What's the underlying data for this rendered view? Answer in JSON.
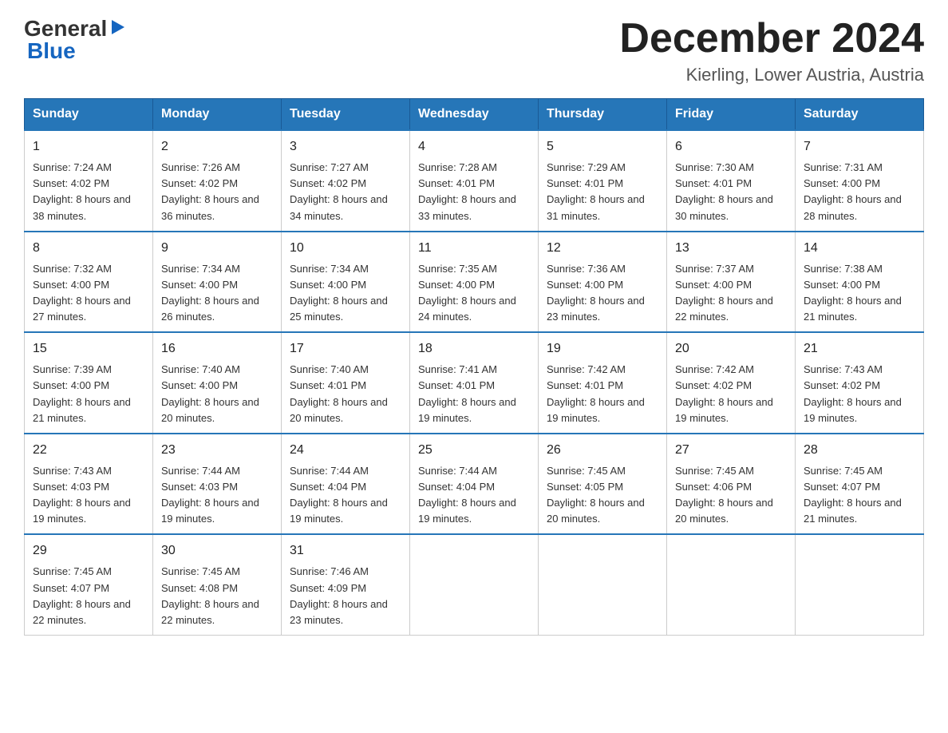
{
  "logo": {
    "line1": "General",
    "arrow": "▶",
    "line2": "Blue"
  },
  "title": {
    "month": "December 2024",
    "location": "Kierling, Lower Austria, Austria"
  },
  "headers": [
    "Sunday",
    "Monday",
    "Tuesday",
    "Wednesday",
    "Thursday",
    "Friday",
    "Saturday"
  ],
  "weeks": [
    [
      {
        "day": "1",
        "sunrise": "7:24 AM",
        "sunset": "4:02 PM",
        "daylight": "8 hours and 38 minutes."
      },
      {
        "day": "2",
        "sunrise": "7:26 AM",
        "sunset": "4:02 PM",
        "daylight": "8 hours and 36 minutes."
      },
      {
        "day": "3",
        "sunrise": "7:27 AM",
        "sunset": "4:02 PM",
        "daylight": "8 hours and 34 minutes."
      },
      {
        "day": "4",
        "sunrise": "7:28 AM",
        "sunset": "4:01 PM",
        "daylight": "8 hours and 33 minutes."
      },
      {
        "day": "5",
        "sunrise": "7:29 AM",
        "sunset": "4:01 PM",
        "daylight": "8 hours and 31 minutes."
      },
      {
        "day": "6",
        "sunrise": "7:30 AM",
        "sunset": "4:01 PM",
        "daylight": "8 hours and 30 minutes."
      },
      {
        "day": "7",
        "sunrise": "7:31 AM",
        "sunset": "4:00 PM",
        "daylight": "8 hours and 28 minutes."
      }
    ],
    [
      {
        "day": "8",
        "sunrise": "7:32 AM",
        "sunset": "4:00 PM",
        "daylight": "8 hours and 27 minutes."
      },
      {
        "day": "9",
        "sunrise": "7:34 AM",
        "sunset": "4:00 PM",
        "daylight": "8 hours and 26 minutes."
      },
      {
        "day": "10",
        "sunrise": "7:34 AM",
        "sunset": "4:00 PM",
        "daylight": "8 hours and 25 minutes."
      },
      {
        "day": "11",
        "sunrise": "7:35 AM",
        "sunset": "4:00 PM",
        "daylight": "8 hours and 24 minutes."
      },
      {
        "day": "12",
        "sunrise": "7:36 AM",
        "sunset": "4:00 PM",
        "daylight": "8 hours and 23 minutes."
      },
      {
        "day": "13",
        "sunrise": "7:37 AM",
        "sunset": "4:00 PM",
        "daylight": "8 hours and 22 minutes."
      },
      {
        "day": "14",
        "sunrise": "7:38 AM",
        "sunset": "4:00 PM",
        "daylight": "8 hours and 21 minutes."
      }
    ],
    [
      {
        "day": "15",
        "sunrise": "7:39 AM",
        "sunset": "4:00 PM",
        "daylight": "8 hours and 21 minutes."
      },
      {
        "day": "16",
        "sunrise": "7:40 AM",
        "sunset": "4:00 PM",
        "daylight": "8 hours and 20 minutes."
      },
      {
        "day": "17",
        "sunrise": "7:40 AM",
        "sunset": "4:01 PM",
        "daylight": "8 hours and 20 minutes."
      },
      {
        "day": "18",
        "sunrise": "7:41 AM",
        "sunset": "4:01 PM",
        "daylight": "8 hours and 19 minutes."
      },
      {
        "day": "19",
        "sunrise": "7:42 AM",
        "sunset": "4:01 PM",
        "daylight": "8 hours and 19 minutes."
      },
      {
        "day": "20",
        "sunrise": "7:42 AM",
        "sunset": "4:02 PM",
        "daylight": "8 hours and 19 minutes."
      },
      {
        "day": "21",
        "sunrise": "7:43 AM",
        "sunset": "4:02 PM",
        "daylight": "8 hours and 19 minutes."
      }
    ],
    [
      {
        "day": "22",
        "sunrise": "7:43 AM",
        "sunset": "4:03 PM",
        "daylight": "8 hours and 19 minutes."
      },
      {
        "day": "23",
        "sunrise": "7:44 AM",
        "sunset": "4:03 PM",
        "daylight": "8 hours and 19 minutes."
      },
      {
        "day": "24",
        "sunrise": "7:44 AM",
        "sunset": "4:04 PM",
        "daylight": "8 hours and 19 minutes."
      },
      {
        "day": "25",
        "sunrise": "7:44 AM",
        "sunset": "4:04 PM",
        "daylight": "8 hours and 19 minutes."
      },
      {
        "day": "26",
        "sunrise": "7:45 AM",
        "sunset": "4:05 PM",
        "daylight": "8 hours and 20 minutes."
      },
      {
        "day": "27",
        "sunrise": "7:45 AM",
        "sunset": "4:06 PM",
        "daylight": "8 hours and 20 minutes."
      },
      {
        "day": "28",
        "sunrise": "7:45 AM",
        "sunset": "4:07 PM",
        "daylight": "8 hours and 21 minutes."
      }
    ],
    [
      {
        "day": "29",
        "sunrise": "7:45 AM",
        "sunset": "4:07 PM",
        "daylight": "8 hours and 22 minutes."
      },
      {
        "day": "30",
        "sunrise": "7:45 AM",
        "sunset": "4:08 PM",
        "daylight": "8 hours and 22 minutes."
      },
      {
        "day": "31",
        "sunrise": "7:46 AM",
        "sunset": "4:09 PM",
        "daylight": "8 hours and 23 minutes."
      },
      null,
      null,
      null,
      null
    ]
  ]
}
